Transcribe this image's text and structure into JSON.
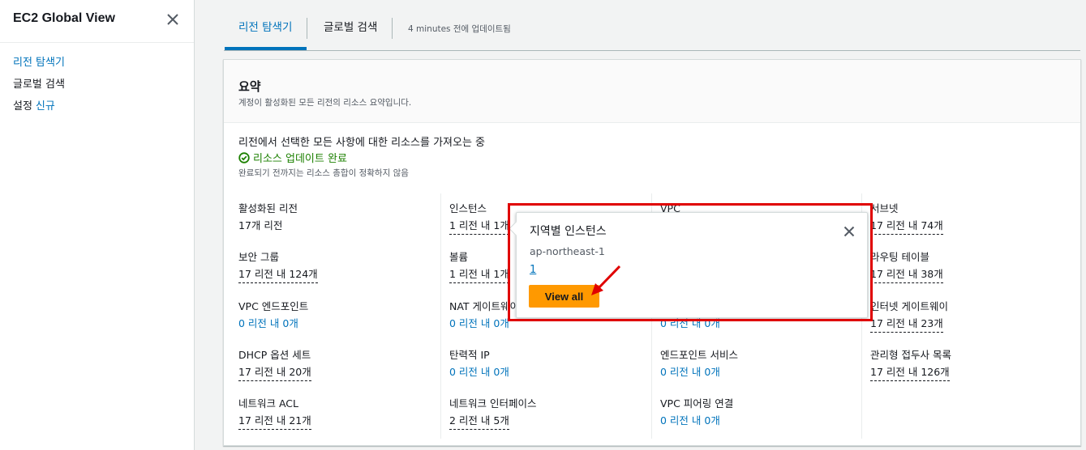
{
  "sidebar": {
    "title": "EC2 Global View",
    "items": [
      {
        "label": "리전 탐색기",
        "active": true
      },
      {
        "label": "글로벌 검색",
        "active": false
      },
      {
        "label": "설정",
        "badge": "신규",
        "active": false
      }
    ]
  },
  "tabs": {
    "items": [
      {
        "label": "리전 탐색기",
        "active": true
      },
      {
        "label": "글로벌 검색",
        "active": false
      }
    ],
    "updated": "4 minutes 전에 업데이트됨"
  },
  "summary": {
    "title": "요약",
    "description": "계정이 활성화된 모든 리전의 리소스 요약입니다.",
    "status_main": "리전에서 선택한 모든 사항에 대한 리소스를 가져오는 중",
    "status_ok": "리소스 업데이트 완료",
    "status_note": "완료되기 전까지는 리소스 총합이 정확하지 않음"
  },
  "metrics": {
    "c1": [
      {
        "label": "활성화된 리전",
        "value": "17개 리전"
      },
      {
        "label": "보안 그룹",
        "value": "17 리전 내 124개"
      },
      {
        "label": "VPC 엔드포인트",
        "value": "0 리전 내 0개"
      },
      {
        "label": "DHCP 옵션 세트",
        "value": "17 리전 내 20개"
      },
      {
        "label": "네트워크 ACL",
        "value": "17 리전 내 21개"
      }
    ],
    "c2": [
      {
        "label": "인스턴스",
        "value": "1 리전 내 1개"
      },
      {
        "label": "볼륨",
        "value": "1 리전 내 1개"
      },
      {
        "label": "NAT 게이트웨이",
        "value": "0 리전 내 0개"
      },
      {
        "label": "탄력적 IP",
        "value": "0 리전 내 0개"
      },
      {
        "label": "네트워크 인터페이스",
        "value": "2 리전 내 5개"
      }
    ],
    "c3": [
      {
        "label": "VPC",
        "value": ""
      },
      {
        "label": "",
        "value": ""
      },
      {
        "label": "",
        "value": "0 리전 내 0개"
      },
      {
        "label": "엔드포인트 서비스",
        "value": "0 리전 내 0개"
      },
      {
        "label": "VPC 피어링 연결",
        "value": "0 리전 내 0개"
      }
    ],
    "c4": [
      {
        "label": "서브넷",
        "value": "17 리전 내 74개"
      },
      {
        "label": "라우팅 테이블",
        "value": "17 리전 내 38개"
      },
      {
        "label": "인터넷 게이트웨이",
        "value": "17 리전 내 23개"
      },
      {
        "label": "관리형 접두사 목록",
        "value": "17 리전 내 126개"
      },
      {
        "label": "",
        "value": ""
      }
    ]
  },
  "popover": {
    "title": "지역별 인스턴스",
    "region": "ap-northeast-1",
    "count": "1",
    "button": "View all"
  },
  "colors": {
    "accent": "#0073bb",
    "button": "#ff9900",
    "success": "#1d8102",
    "highlight": "#e00000"
  }
}
